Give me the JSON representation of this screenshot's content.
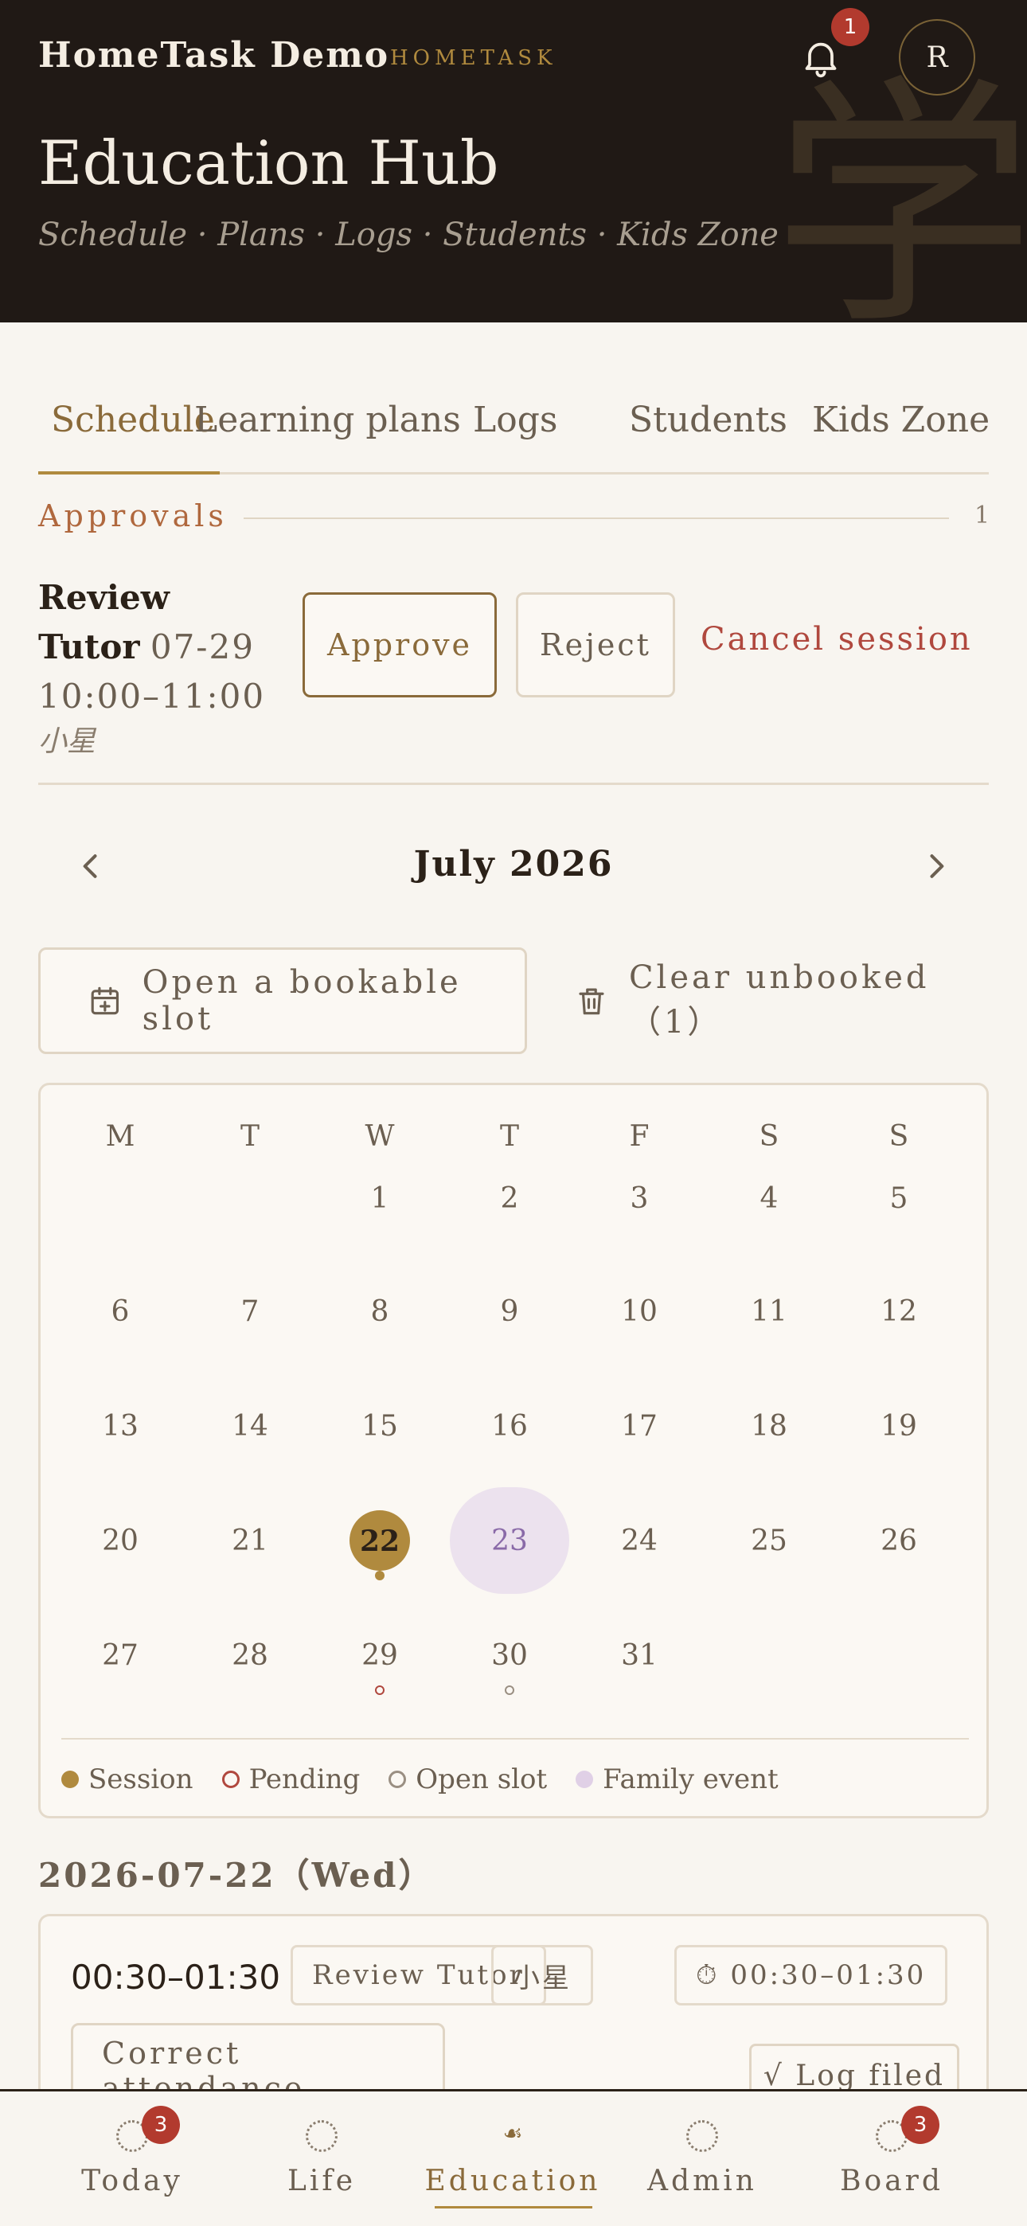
{
  "header": {
    "brand": "HomeTask  Demo",
    "brand_sub": "HOMETASK",
    "notification_count": "1",
    "avatar_initial": "R",
    "title": "Education Hub",
    "subtitle": "Schedule · Plans · Logs · Students · Kids Zone",
    "watermark": "学"
  },
  "tabs": [
    {
      "label": "Schedule",
      "active": true
    },
    {
      "label": "Learning plans",
      "active": false
    },
    {
      "label": "Logs",
      "active": false
    },
    {
      "label": "Students",
      "active": false
    },
    {
      "label": "Kids Zone",
      "active": false
    }
  ],
  "approvals": {
    "heading": "Approvals",
    "count": "1",
    "item": {
      "title_line1": "Review",
      "title_line2": "Tutor",
      "date": "07-29",
      "time": "10:00–11:00",
      "student": "小星",
      "approve_label": "Approve",
      "reject_label": "Reject",
      "cancel_label": "Cancel session"
    }
  },
  "calendar": {
    "month_label": "July  2026",
    "open_slot_label": "Open a bookable slot",
    "clear_label": "Clear unbooked（1）",
    "weekdays": [
      "M",
      "T",
      "W",
      "T",
      "F",
      "S",
      "S"
    ],
    "weeks": [
      [
        "",
        "",
        "1",
        "2",
        "3",
        "4",
        "5"
      ],
      [
        "6",
        "7",
        "8",
        "9",
        "10",
        "11",
        "12"
      ],
      [
        "13",
        "14",
        "15",
        "16",
        "17",
        "18",
        "19"
      ],
      [
        "20",
        "21",
        "22",
        "23",
        "24",
        "25",
        "26"
      ],
      [
        "27",
        "28",
        "29",
        "30",
        "31",
        "",
        ""
      ]
    ],
    "today": "22",
    "family_event_days": [
      "23"
    ],
    "session_days": [
      "22"
    ],
    "pending_days": [
      "29"
    ],
    "open_slot_days": [
      "30"
    ],
    "legend": [
      {
        "label": "Session",
        "color": "#b08a3e",
        "style": "filled"
      },
      {
        "label": "Pending",
        "color": "#b0483e",
        "style": "ring"
      },
      {
        "label": "Open slot",
        "color": "#9a8f82",
        "style": "ring"
      },
      {
        "label": "Family event",
        "color": "#e0d0e6",
        "style": "filled"
      }
    ]
  },
  "day_detail": {
    "heading": "2026-07-22（Wed）",
    "session": {
      "time": "00:30–01:30",
      "kind": "Review Tutor",
      "student": "小星",
      "time_chip": "⏱ 00:30–01:30",
      "correct_label": "Correct attendance",
      "log_label": "√ Log filed"
    }
  },
  "bottom_nav": [
    {
      "label": "Today",
      "badge": "3",
      "active": false
    },
    {
      "label": "Life",
      "badge": "",
      "active": false
    },
    {
      "label": "Education",
      "badge": "",
      "active": true
    },
    {
      "label": "Admin",
      "badge": "",
      "active": false
    },
    {
      "label": "Board",
      "badge": "3",
      "active": false
    }
  ],
  "colors": {
    "accent": "#b08a3e",
    "danger": "#b23a2e",
    "header_bg": "#201915",
    "background": "#f8f5f0"
  }
}
